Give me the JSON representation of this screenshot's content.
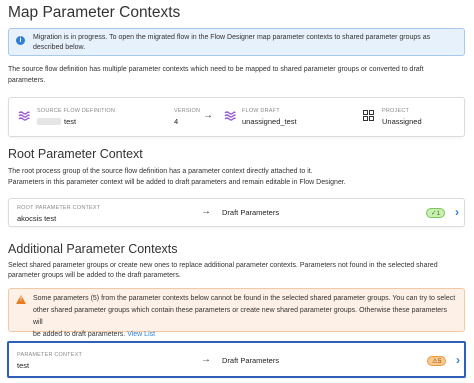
{
  "page": {
    "title": "Map Parameter Contexts"
  },
  "info_banner": {
    "icon": "info-icon",
    "text": "Migration is in progress. To open the migrated flow in the Flow Designer map parameter contexts to shared parameter groups as described below."
  },
  "intro": "The source flow definition has multiple parameter contexts which need to be mapped to shared parameter groups or converted to draft parameters.",
  "flow_summary": {
    "source_label": "SOURCE FLOW DEFINITION",
    "source_value": "test",
    "version_label": "VERSION",
    "version_value": "4",
    "draft_label": "FLOW DRAFT",
    "draft_value": "unassigned_test",
    "project_label": "PROJECT",
    "project_value": "Unassigned"
  },
  "root_section": {
    "title": "Root Parameter Context",
    "desc_line1": "The root process group of the source flow definition has a parameter context directly attached to it.",
    "desc_line2": "Parameters in this parameter context will be added to draft parameters and remain editable in Flow Designer.",
    "card": {
      "label": "ROOT PARAMETER CONTEXT",
      "value": "akocsis test",
      "target": "Draft Parameters",
      "badge": "1"
    }
  },
  "additional_section": {
    "title": "Additional Parameter Contexts",
    "desc_line1": "Select shared parameter groups or create new ones to replace additional parameter contexts. Parameters not found in the selected shared",
    "desc_line2": "parameter groups will be added to the draft parameters.",
    "warning_line1": "Some parameters (5) from the parameter contexts below cannot be found in the selected shared parameter groups. You can try to select",
    "warning_line2": "other shared parameter groups which contain these parameters or create new shared parameter groups. Otherwise these parameters will",
    "warning_line3_pre": "be added to draft parameters.",
    "warning_link": "View List",
    "card": {
      "label": "PARAMETER CONTEXT",
      "value": "test",
      "target": "Draft Parameters",
      "badge": "5"
    }
  },
  "colors": {
    "accent": "#2f7ed8",
    "warning": "#e87c1e",
    "success": "#7ac85a",
    "selection": "#2f5fb8"
  }
}
